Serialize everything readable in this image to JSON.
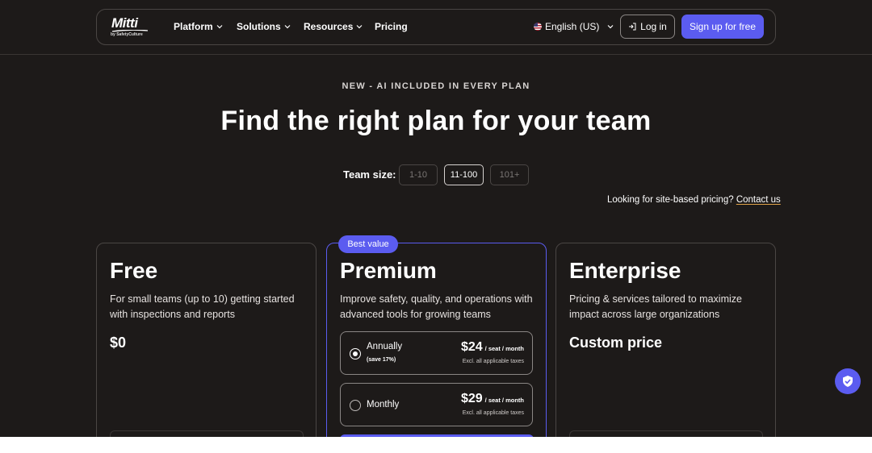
{
  "nav": {
    "logo_text": "Mitti",
    "logo_sub": "by SafetyCulture",
    "items": [
      {
        "label": "Platform",
        "has_caret": true
      },
      {
        "label": "Solutions",
        "has_caret": true
      },
      {
        "label": "Resources",
        "has_caret": true
      },
      {
        "label": "Pricing",
        "has_caret": false
      }
    ],
    "language": "English (US)",
    "login_label": "Log in",
    "signup_label": "Sign up for free"
  },
  "hero": {
    "eyebrow": "NEW - AI INCLUDED IN EVERY PLAN",
    "headline": "Find the right plan for your team"
  },
  "team_size": {
    "label": "Team size:",
    "options": [
      "1-10",
      "11-100",
      "101+"
    ],
    "selected": "11-100"
  },
  "site_pricing": {
    "text": "Looking for site-based pricing?",
    "link": "Contact us"
  },
  "plans": {
    "free": {
      "title": "Free",
      "description": "For small teams (up to 10) getting started with inspections and reports",
      "price": "$0"
    },
    "premium": {
      "badge": "Best value",
      "title": "Premium",
      "description": "Improve safety, quality, and operations with advanced tools for growing teams",
      "billing_options": [
        {
          "label": "Annually",
          "note": "(save 17%)",
          "price": "$24",
          "per": "/ seat / month",
          "tax": "Excl. all applicable taxes",
          "selected": true
        },
        {
          "label": "Monthly",
          "note": "",
          "price": "$29",
          "per": "/ seat / month",
          "tax": "Excl. all applicable taxes",
          "selected": false
        }
      ]
    },
    "enterprise": {
      "title": "Enterprise",
      "description": "Pricing & services tailored to maximize impact across large organizations",
      "price": "Custom price"
    }
  },
  "colors": {
    "background": "#1d1a19",
    "accent": "#5b5cf0",
    "border": "#4a4644",
    "link_underline": "#e0a34a"
  },
  "icons": {
    "caret": "chevron-down-icon",
    "login": "login-arrow-icon",
    "flag": "us-flag-icon",
    "floating": "shield-check-icon"
  }
}
